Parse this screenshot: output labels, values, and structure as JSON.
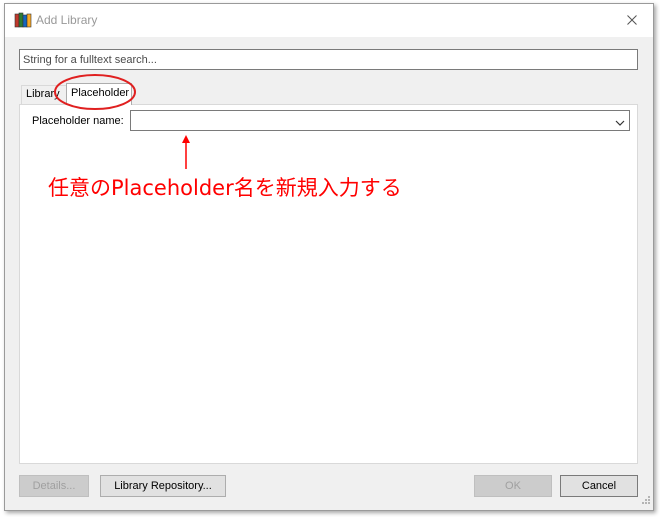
{
  "window": {
    "title": "Add Library",
    "app_icon": "books-icon",
    "close_icon": "close-icon"
  },
  "search": {
    "placeholder": "String for a fulltext search..."
  },
  "tabs": [
    {
      "label": "Library",
      "selected": false
    },
    {
      "label": "Placeholder",
      "selected": true
    }
  ],
  "placeholder_tab": {
    "field_label": "Placeholder name:",
    "field_value": "",
    "dropdown_icon": "chevron-down-icon"
  },
  "annotation": {
    "text": "任意のPlaceholder名を新規入力する",
    "color": "#ff0000"
  },
  "buttons": {
    "details": {
      "label": "Details...",
      "enabled": false
    },
    "repository": {
      "label": "Library Repository...",
      "enabled": true
    },
    "ok": {
      "label": "OK",
      "enabled": false
    },
    "cancel": {
      "label": "Cancel",
      "enabled": true
    }
  }
}
